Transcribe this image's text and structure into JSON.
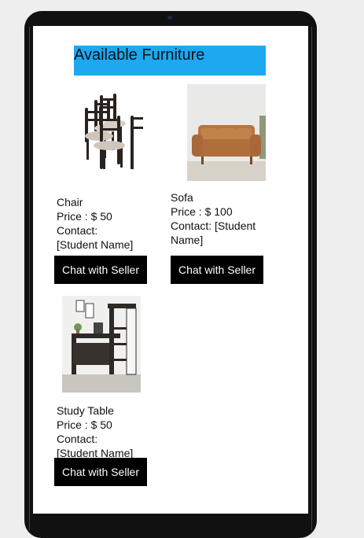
{
  "page": {
    "title": "Available Furniture"
  },
  "items": [
    {
      "name": "Chair",
      "price": "Price : $ 50",
      "contact_label": "Contact:",
      "contact_value": "[Student Name]",
      "button": "Chat with Seller",
      "image": "dining-chairs-image"
    },
    {
      "name": "Sofa",
      "price": "Price : $ 100",
      "contact_label": "Contact: [Student",
      "contact_value": "Name]",
      "button": "Chat with Seller",
      "image": "leather-sofa-image"
    },
    {
      "name": "Study Table",
      "price": "Price : $ 50",
      "contact_label": "Contact:",
      "contact_value": "[Student Name]",
      "button": "Chat with Seller",
      "image": "study-desk-image"
    }
  ],
  "colors": {
    "title_bg": "#1da8f0",
    "button_bg": "#000000",
    "button_text": "#ffffff"
  }
}
